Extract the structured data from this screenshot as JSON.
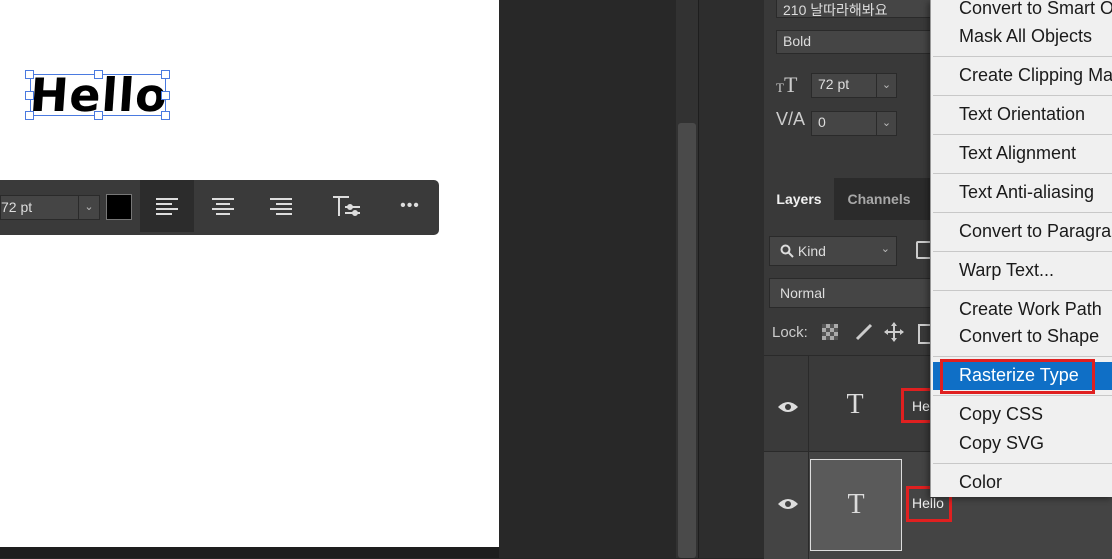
{
  "canvas": {
    "text": "Hello"
  },
  "toolbar": {
    "size_value": "72 pt",
    "color": "#000000",
    "more_label": "•••"
  },
  "properties": {
    "font_preview": "210 날따라해봐요",
    "font_style": "Bold",
    "font_size": "72 pt",
    "tracking": "0"
  },
  "layers_panel": {
    "tabs": [
      "Layers",
      "Channels"
    ],
    "filter_label": "Kind",
    "blend_mode": "Normal",
    "lock_label": "Lock:",
    "layers": [
      {
        "thumb_glyph": "T",
        "name": "He"
      },
      {
        "thumb_glyph": "T",
        "name": "Hello"
      }
    ]
  },
  "context_menu": {
    "items": [
      "Convert to Smart O",
      "Mask All Objects",
      "Create Clipping Ma",
      "Text Orientation",
      "Text Alignment",
      "Text Anti-aliasing",
      "Convert to Paragrap",
      "Warp Text...",
      "Create Work Path",
      "Convert to Shape",
      "Rasterize Type",
      "Copy CSS",
      "Copy SVG",
      "Color"
    ],
    "highlighted": "Rasterize Type",
    "highlight_color": "#0f6fc6"
  },
  "annotation_color": "#e02020"
}
